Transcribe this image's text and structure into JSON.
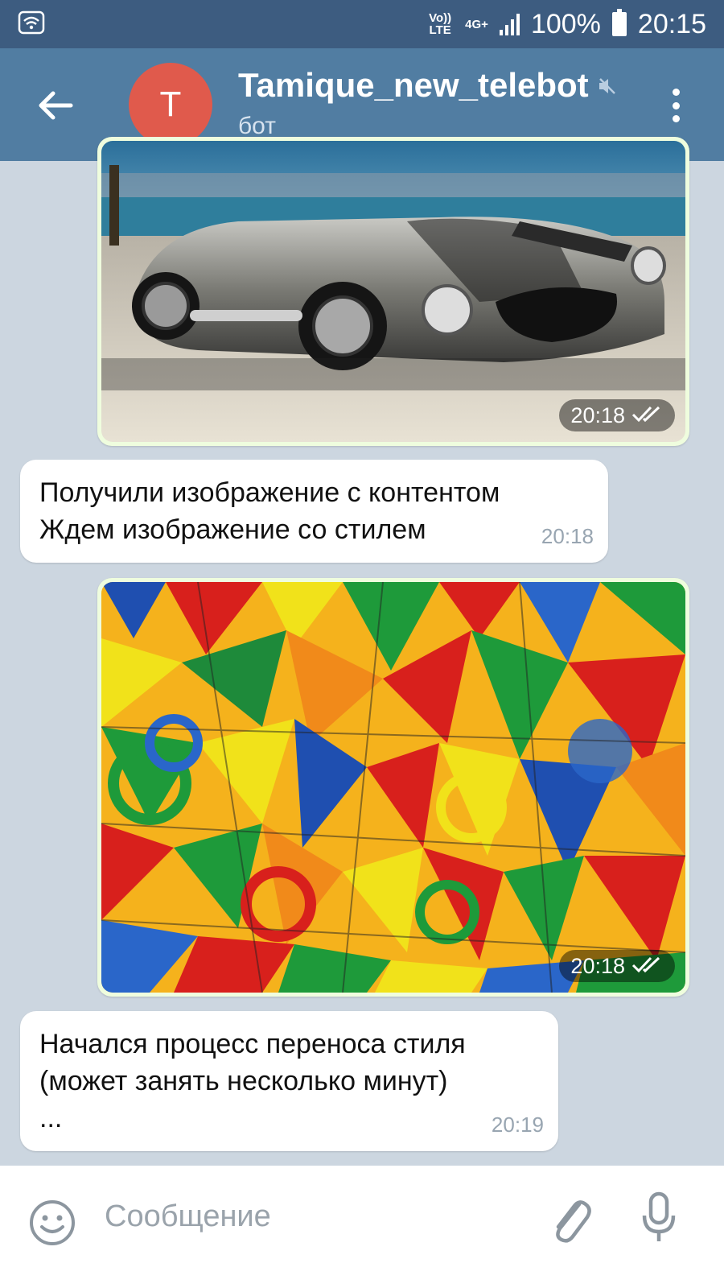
{
  "status_bar": {
    "volte": "Vo)) LTE",
    "network": "4G+",
    "battery": "100%",
    "clock": "20:15"
  },
  "header": {
    "avatar_letter": "T",
    "title": "Tamique_new_telebot",
    "subtitle": "бот",
    "avatar_color": "#e05a4c",
    "bar_color": "#517da2"
  },
  "messages": [
    {
      "type": "photo",
      "subject": "silver sports car",
      "time": "20:18",
      "status": "read"
    },
    {
      "type": "text",
      "lines": [
        "Получили изображение с контентом",
        "Ждем изображение со стилем"
      ],
      "time": "20:18"
    },
    {
      "type": "photo",
      "subject": "colorful geometric painting",
      "time": "20:18",
      "status": "read"
    },
    {
      "type": "text",
      "lines": [
        "Начался процесс переноса стиля",
        "(может занять несколько минут)",
        "..."
      ],
      "time": "20:19"
    }
  ],
  "input": {
    "placeholder": "Сообщение"
  },
  "icons": {
    "back": "arrow-left-icon",
    "mute": "muted-speaker-icon",
    "menu": "more-vertical-icon",
    "emoji": "smiley-icon",
    "attach": "paperclip-icon",
    "mic": "microphone-icon"
  },
  "colors": {
    "outgoing_bubble": "#effdde",
    "incoming_bubble": "#ffffff",
    "chat_background": "#ccd6e0"
  }
}
